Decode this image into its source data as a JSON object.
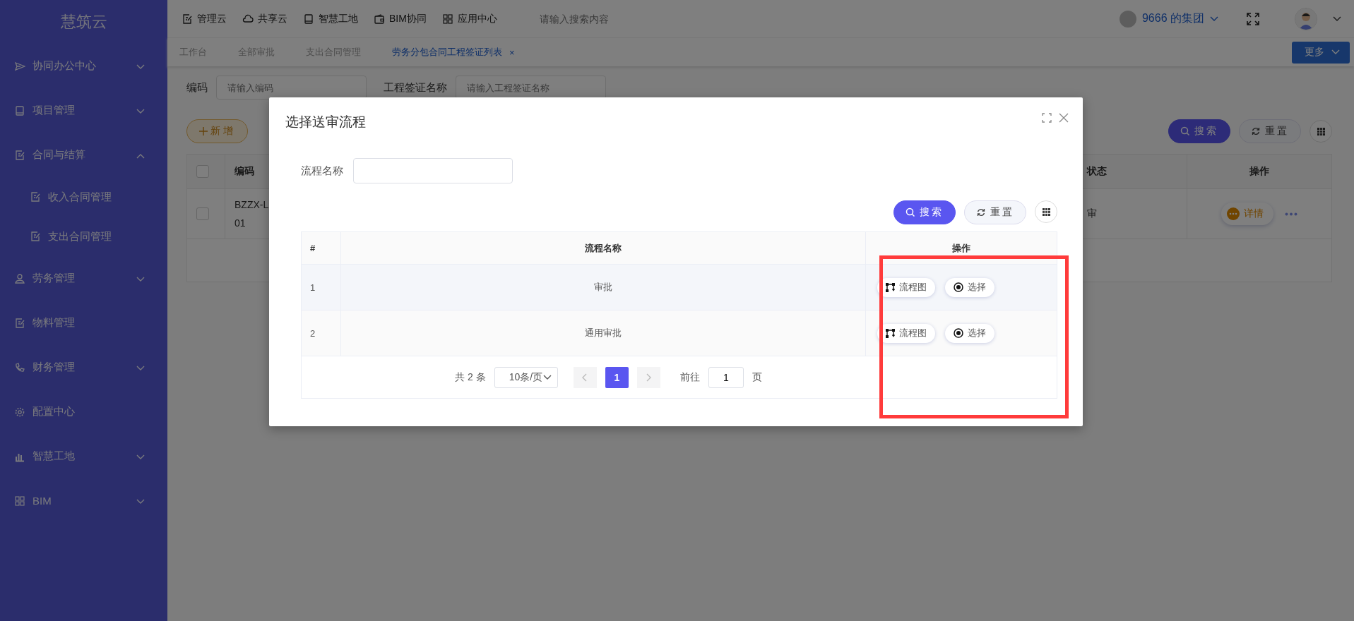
{
  "sidebar": {
    "logo": "慧筑云",
    "items": [
      {
        "label": "协同办公中心",
        "expanded": false
      },
      {
        "label": "项目管理",
        "expanded": false
      },
      {
        "label": "合同与结算",
        "expanded": true,
        "children": [
          {
            "label": "收入合同管理"
          },
          {
            "label": "支出合同管理"
          }
        ]
      },
      {
        "label": "劳务管理",
        "expanded": false
      },
      {
        "label": "物料管理"
      },
      {
        "label": "财务管理",
        "expanded": false
      },
      {
        "label": "配置中心"
      },
      {
        "label": "智慧工地",
        "expanded": false
      },
      {
        "label": "BIM",
        "expanded": false
      }
    ]
  },
  "top_bar": {
    "nav": [
      "管理云",
      "共享云",
      "智慧工地",
      "BIM协同",
      "应用中心"
    ],
    "search": {
      "placeholder": "请输入搜索内容"
    },
    "organization": "9666 的集团"
  },
  "tabs": [
    {
      "label": "工作台",
      "selected": false
    },
    {
      "label": "全部审批",
      "selected": false
    },
    {
      "label": "支出合同管理",
      "selected": false
    },
    {
      "label": "劳务分包合同工程签证列表",
      "selected": true,
      "close": "×"
    }
  ],
  "more_button": "更多",
  "filters": [
    {
      "label": "编码",
      "placeholder": "请输入编码"
    },
    {
      "label": "工程签证名称",
      "placeholder": "请输入工程签证名称"
    }
  ],
  "add_button": "新增",
  "search_button": "搜索",
  "reset_button": "重置",
  "table": {
    "header_checked": false,
    "columns": [
      "编码",
      "状态",
      "操作"
    ],
    "rows": [
      {
        "checked": false,
        "code_lines": [
          "BZZX-L",
          "01"
        ],
        "status": "审",
        "action": "详情"
      }
    ]
  },
  "dialog": {
    "title": "选择送审流程",
    "field": {
      "label": "流程名称"
    },
    "search_button": "搜索",
    "reset_button": "重置",
    "columns": [
      "#",
      "流程名称",
      "操作"
    ],
    "rows": [
      {
        "index": "1",
        "name": "审批",
        "actions": [
          "流程图",
          "选择"
        ]
      },
      {
        "index": "2",
        "name": "通用审批",
        "actions": [
          "流程图",
          "选择"
        ]
      }
    ],
    "pagination": {
      "total": "共 2 条",
      "page_size": "10条/页",
      "pages": [
        {
          "label": "1",
          "selected": true
        }
      ],
      "goto": "前往",
      "goto_value": "1",
      "page_unit": "页"
    }
  }
}
